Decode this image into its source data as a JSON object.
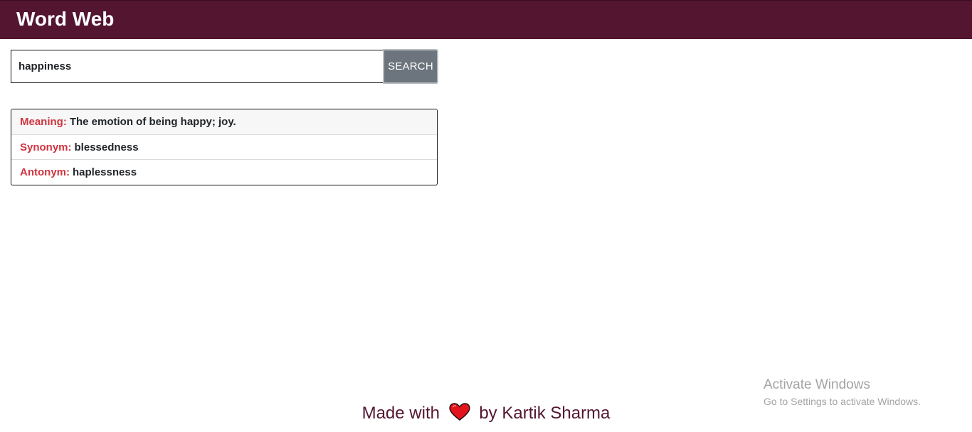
{
  "header": {
    "brand": "Word Web",
    "background": "#541530"
  },
  "search": {
    "value": "happiness",
    "button_label": "SEARCH"
  },
  "results": [
    {
      "label": "Meaning:",
      "value": "The emotion of being happy; joy."
    },
    {
      "label": "Synonym:",
      "value": "blessedness"
    },
    {
      "label": "Antonym:",
      "value": "haplessness"
    }
  ],
  "colors": {
    "label_red": "#d0343f",
    "footer_text": "#541530",
    "button_gray": "#6c757d"
  },
  "footer": {
    "prefix": "Made with",
    "icon": "heart-icon",
    "suffix": "by Kartik Sharma"
  },
  "watermark": {
    "line1": "Activate Windows",
    "line2": "Go to Settings to activate Windows."
  }
}
